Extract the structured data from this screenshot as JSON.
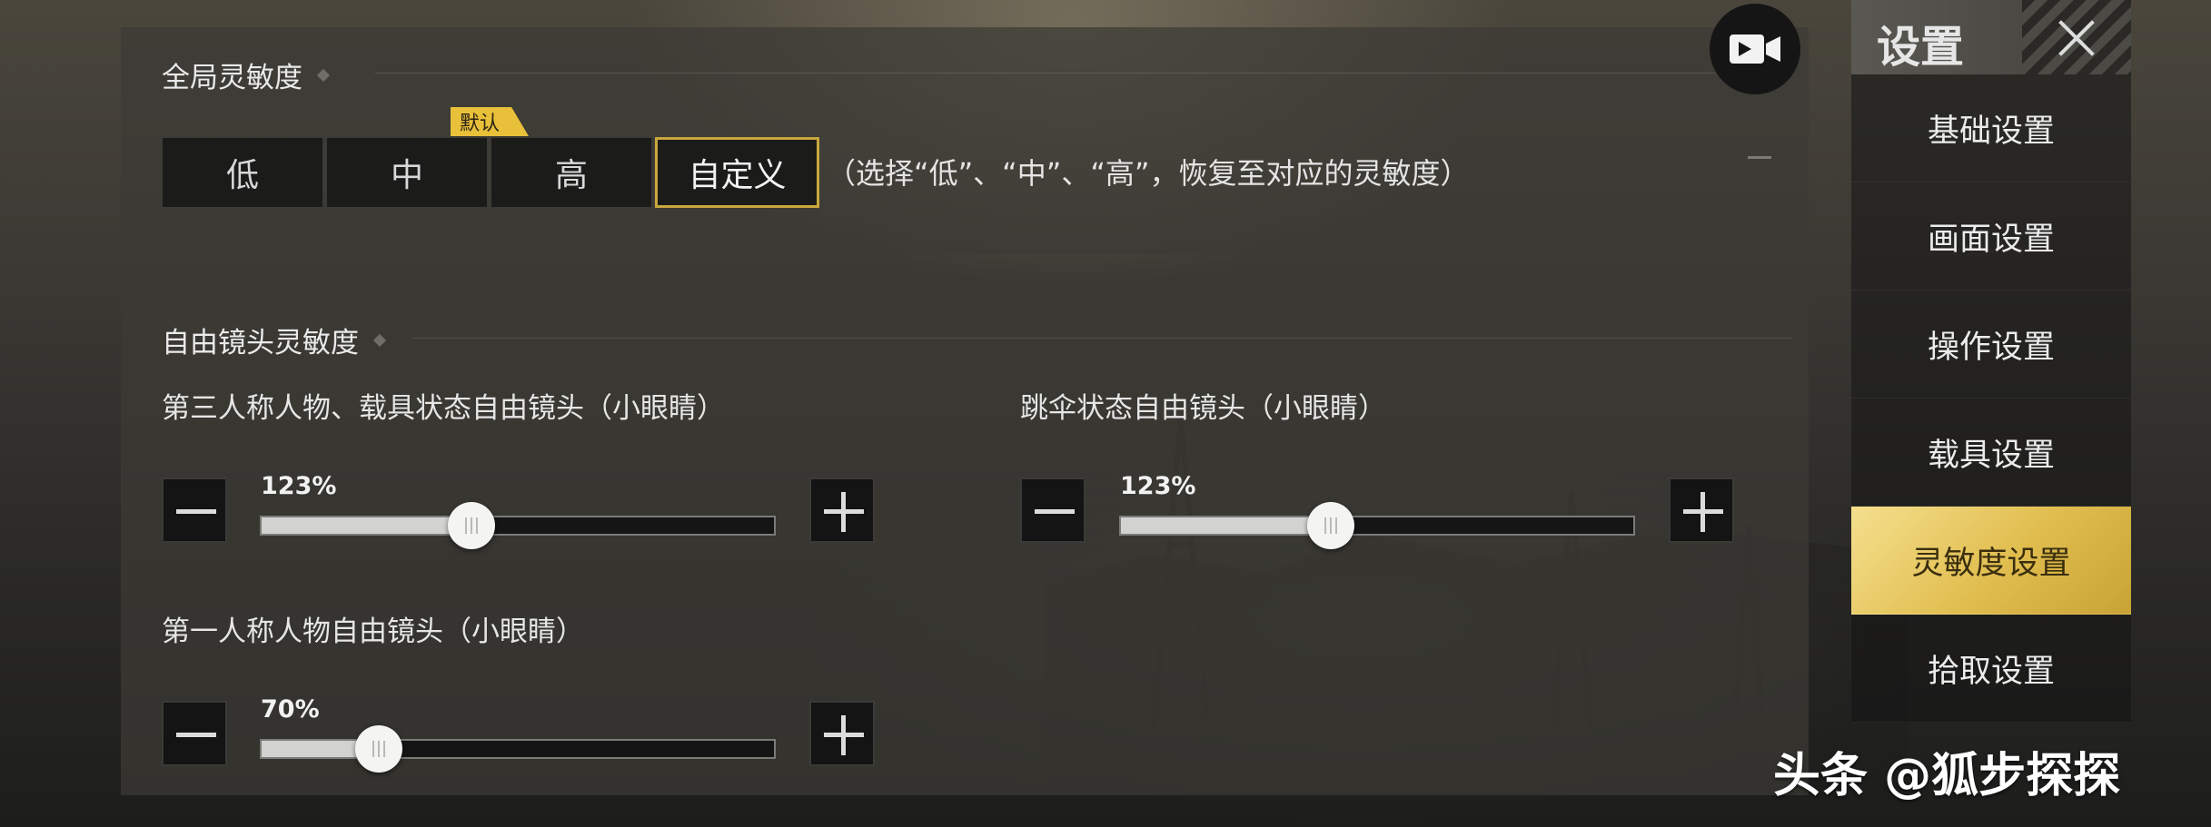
{
  "colors": {
    "accent": "#c9a73c",
    "active_menu": "#e0bd4e",
    "default_tag": "#e8c03a"
  },
  "global": {
    "title": "全局灵敏度",
    "default_tag": "默认",
    "options": [
      "低",
      "中",
      "高",
      "自定义"
    ],
    "selected": "自定义",
    "hint": "（选择“低”、“中”、“高”，恢复至对应的灵敏度）"
  },
  "free_camera": {
    "title": "自由镜头灵敏度",
    "sliders": [
      {
        "label": "第三人称人物、载具状态自由镜头（小眼睛）",
        "value_text": "123%",
        "fraction": 0.41
      },
      {
        "label": "跳伞状态自由镜头（小眼睛）",
        "value_text": "123%",
        "fraction": 0.41
      },
      {
        "label": "第一人称人物自由镜头（小眼睛）",
        "value_text": "70%",
        "fraction": 0.23
      }
    ]
  },
  "sidebar": {
    "title": "设置",
    "items": [
      "基础设置",
      "画面设置",
      "操作设置",
      "载具设置",
      "灵敏度设置",
      "拾取设置"
    ],
    "active": "灵敏度设置"
  },
  "icons": {
    "record": "video-camera-icon",
    "close": "close-icon",
    "minus": "minus-icon",
    "plus": "plus-icon"
  },
  "watermark": "头条 @狐步探探"
}
